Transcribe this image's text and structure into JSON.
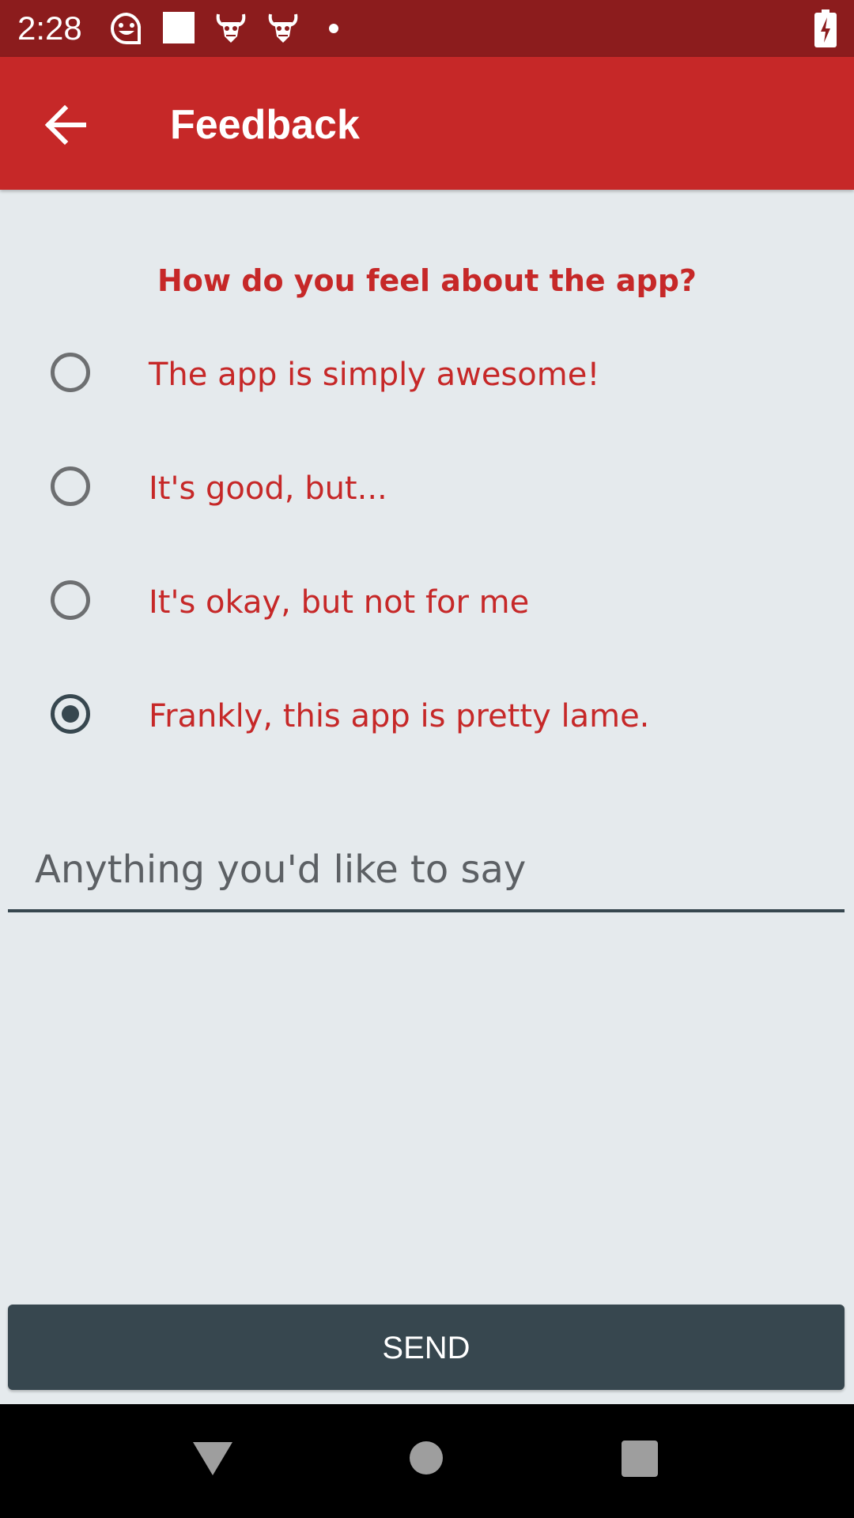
{
  "status_bar": {
    "time": "2:28",
    "icons": [
      "emoji-icon",
      "square-notification-icon",
      "demon-icon",
      "demon-icon",
      "dot-icon",
      "battery-charging-icon"
    ]
  },
  "app_bar": {
    "title": "Feedback",
    "back_icon": "arrow-back-icon"
  },
  "form": {
    "question": "How do you feel about the app?",
    "options": [
      {
        "label": "The app is simply awesome!",
        "checked": false
      },
      {
        "label": "It's good, but...",
        "checked": false
      },
      {
        "label": "It's okay, but not for me",
        "checked": false
      },
      {
        "label": "Frankly, this app is pretty lame.",
        "checked": true
      }
    ],
    "comment_placeholder": "Anything you'd like to say",
    "comment_value": "",
    "send_label": "SEND"
  },
  "nav_bar": {
    "icons": [
      "back-triangle-icon",
      "home-circle-icon",
      "recents-square-icon"
    ]
  },
  "colors": {
    "status_bar": "#8c1c1d",
    "app_bar": "#c62828",
    "accent_text": "#c62828",
    "background": "#e5eaed",
    "button": "#37474f"
  }
}
